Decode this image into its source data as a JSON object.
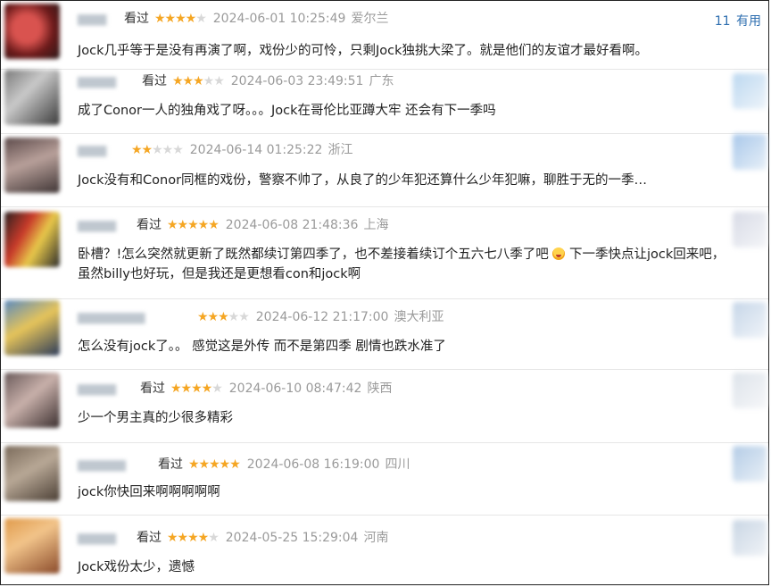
{
  "reviews": [
    {
      "user": "",
      "status": "看过",
      "rating": 4,
      "time": "2024-06-01 10:25:49",
      "location": "爱尔兰",
      "helpful_count": "11",
      "helpful_label": "有用",
      "content": "Jock几乎等于是没有再演了啊，戏份少的可怜，只剩Jock独挑大梁了。就是他们的友谊才最好看啊。"
    },
    {
      "user": "",
      "status": "看过",
      "rating": 3,
      "time": "2024-06-03 23:49:51",
      "location": "广东",
      "content": "成了Conor一人的独角戏了呀。。。Jock在哥伦比亚蹲大牢 还会有下一季吗"
    },
    {
      "user": "",
      "status": "",
      "rating": 2,
      "time": "2024-06-14 01:25:22",
      "location": "浙江",
      "content": "Jock没有和Conor同框的戏份，警察不帅了，从良了的少年犯还算什么少年犯嘛，聊胜于无的一季…"
    },
    {
      "user": "",
      "status": "看过",
      "rating": 5,
      "time": "2024-06-08 21:48:36",
      "location": "上海",
      "content_a": "卧槽？!怎么突然就更新了既然都续订第四季了，也不差接着续订个五六七八季了吧",
      "content_b": "下一季快点让jock回来吧，虽然billy也好玩，但是我还是更想看con和jock啊"
    },
    {
      "user": "",
      "status": "",
      "rating": 3,
      "time": "2024-06-12 21:17:00",
      "location": "澳大利亚",
      "content": "怎么没有jock了。。 感觉这是外传 而不是第四季 剧情也跌水准了"
    },
    {
      "user": "",
      "status": "看过",
      "rating": 4,
      "time": "2024-06-10 08:47:42",
      "location": "陕西",
      "content": "少一个男主真的少很多精彩"
    },
    {
      "user": "",
      "status": "看过",
      "rating": 5,
      "time": "2024-06-08 16:19:00",
      "location": "四川",
      "content": "jock你快回来啊啊啊啊啊"
    },
    {
      "user": "",
      "status": "看过",
      "rating": 4,
      "time": "2024-05-25 15:29:04",
      "location": "河南",
      "content": "Jock戏份太少，遗憾"
    }
  ],
  "colors": {
    "star_on": "#f5a623",
    "star_off": "#d8d8d8",
    "link": "#2f6fb0",
    "meta": "#9a9a9a"
  }
}
